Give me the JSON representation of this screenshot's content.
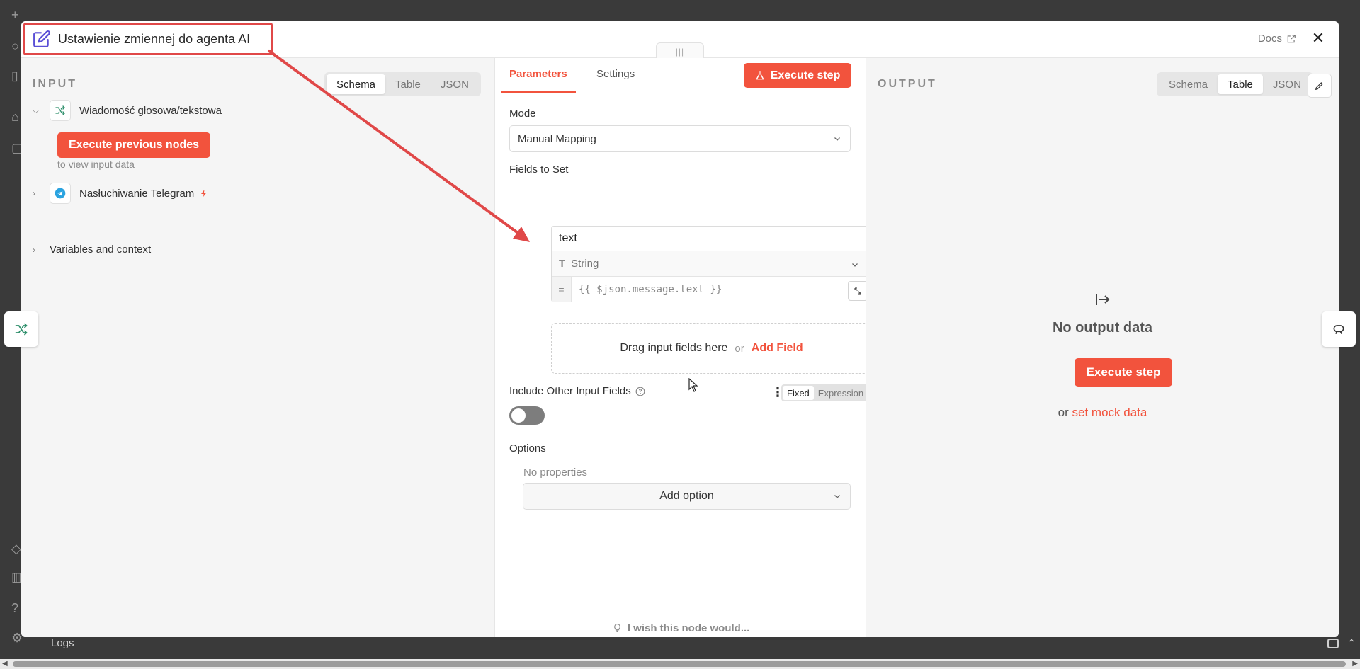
{
  "modal": {
    "title": "Ustawienie zmiennej do agenta AI",
    "docs_label": "Docs",
    "close_label": "✕",
    "handle_label": "|||"
  },
  "input_panel": {
    "label": "INPUT",
    "view_tabs": [
      "Schema",
      "Table",
      "JSON"
    ],
    "active_tab": "Schema",
    "node1": {
      "name": "Wiadomość głosowa/tekstowa",
      "execute_label": "Execute previous nodes",
      "hint": "to view input data"
    },
    "node2": {
      "name": "Nasłuchiwanie Telegram"
    },
    "variables_label": "Variables and context"
  },
  "params_panel": {
    "tabs": [
      "Parameters",
      "Settings"
    ],
    "active_tab": "Parameters",
    "execute_label": "Execute step",
    "mode_label": "Mode",
    "mode_value": "Manual Mapping",
    "fields_label": "Fields to Set",
    "field": {
      "name": "text",
      "type": "String",
      "expression": "{{ $json.message.text }}"
    },
    "drop_text": "Drag input fields here",
    "drop_or": "or",
    "add_field_label": "Add Field",
    "include_label": "Include Other Input Fields",
    "fixed_label": "Fixed",
    "expression_label": "Expression",
    "options_label": "Options",
    "no_properties": "No properties",
    "add_option_label": "Add option",
    "wish_text": "I wish this node would..."
  },
  "output_panel": {
    "label": "OUTPUT",
    "view_tabs": [
      "Schema",
      "Table",
      "JSON"
    ],
    "active_tab": "Table",
    "no_data": "No output data",
    "execute_label": "Execute step",
    "or": "or",
    "mock_link": "set mock data"
  },
  "background": {
    "logs_label": "Logs"
  },
  "colors": {
    "accent": "#f2533d",
    "annotation": "#e04848",
    "edit_icon": "#5a4fd6",
    "node_green": "#2e8f6b",
    "telegram": "#2aa3e0"
  }
}
